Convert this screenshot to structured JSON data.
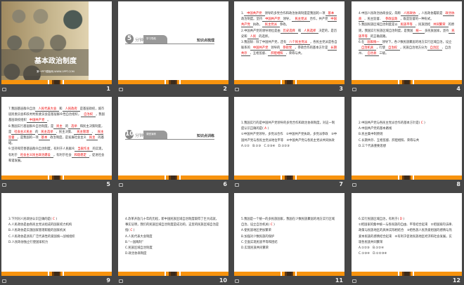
{
  "slides": [
    {
      "num": "1",
      "type": "title",
      "title": "基本政治制度",
      "subtitle": "第一PPT模板网-WWW.1PPT.COM"
    },
    {
      "num": "2",
      "type": "section",
      "badge_num": "5",
      "badge_label": "分钟",
      "badge_tag": "学习导航",
      "heading": "知识点梳理"
    },
    {
      "num": "3",
      "type": "text",
      "paras": [
        [
          [
            "1.",
            0
          ],
          [
            "中国共产党",
            1
          ],
          [
            "领导的多党合作和政治协商制度是我国的一项",
            0
          ],
          [
            "基本",
            1
          ],
          [
            "政治制度。坚持",
            0
          ],
          [
            "中国共产党",
            1
          ],
          [
            "领导，",
            0
          ],
          [
            "民主党派",
            1
          ],
          [
            "合作，共产党",
            0
          ],
          [
            "中国共产党",
            1
          ],
          [
            "执政，",
            0
          ],
          [
            "民主党派",
            1
          ],
          [
            "参政。",
            0
          ]
        ],
        [
          [
            "2.中国共产党的领导地位是由",
            0
          ],
          [
            "历史选择",
            1
          ],
          [
            "和",
            0
          ],
          [
            "人民选择",
            1
          ],
          [
            "决定的，是历史和",
            0
          ],
          [
            "人民",
            1
          ],
          [
            "的选择。",
            0
          ]
        ],
        [
          [
            "3.我国除：除了中国共产党，还有",
            0
          ],
          [
            "八个民主党派",
            1
          ],
          [
            "，各民主党派是各自联系的",
            0
          ],
          [
            "中国共产党",
            1
          ],
          [
            "领导的",
            0
          ],
          [
            "参政党",
            1
          ],
          [
            "，参政合作的基本方针是",
            0
          ],
          [
            "长期共存",
            1
          ],
          [
            "、互相监督、",
            0
          ],
          [
            "肝胆相照",
            1
          ],
          [
            "、荣辱与共。",
            0
          ]
        ]
      ]
    },
    {
      "num": "4",
      "type": "text",
      "paras": [
        [
          [
            "4.中国人民政治协商会议，简称",
            0
          ],
          [
            "人民政协",
            1
          ],
          [
            "，人民政协履职是",
            0
          ],
          [
            "政治协商",
            1
          ],
          [
            "、民主监督、",
            0
          ],
          [
            "参政议政",
            1
          ],
          [
            "，既是监督的一种形式。",
            0
          ]
        ],
        [
          [
            "5.我国民族区域自治制度是以",
            0
          ],
          [
            "民族平等",
            1
          ],
          [
            "、民族团结",
            0
          ],
          [
            "共同繁荣",
            1
          ],
          [
            "的原则，我国实行民族区域自治制度，是我国",
            0
          ],
          [
            "统一",
            1
          ],
          [
            "多民族国家，坚持",
            0
          ],
          [
            "民族平等",
            1
          ],
          [
            "的正确道路。",
            0
          ]
        ],
        [
          [
            "6.在",
            0
          ],
          [
            "国家统一",
            1
          ],
          [
            "领导下，各少数民族聚居的地方实行区域自治，设立",
            0
          ],
          [
            "自治机关",
            1
          ],
          [
            "，行使",
            0
          ],
          [
            "自治权",
            1
          ],
          [
            "，民族自治地方分为",
            0
          ],
          [
            "自治区",
            1
          ],
          [
            "、自治州、",
            0
          ],
          [
            "自治县",
            1
          ],
          [
            "三级。",
            0
          ]
        ]
      ]
    },
    {
      "num": "5",
      "type": "text",
      "paras": [
        [
          [
            "7.我国基层群众自治",
            0
          ],
          [
            "人民代表大会",
            1
          ],
          [
            "和",
            0
          ],
          [
            "人民政府",
            1
          ],
          [
            "是基层政权，城市居民委员会和农村村民委员会是基层群众性自治组织，",
            0
          ],
          [
            "自治权",
            1
          ],
          [
            "，我国基层政权组织",
            0
          ],
          [
            "中国共产党",
            1
          ],
          [
            "。",
            0
          ]
        ],
        [
          [
            "8.我国实行基层群众自治制度，是",
            0
          ],
          [
            "民主",
            1
          ],
          [
            "的",
            0
          ],
          [
            "选举",
            1
          ],
          [
            "和民主决策制度，是",
            0
          ],
          [
            "社会主义民主",
            1
          ],
          [
            "的",
            0
          ],
          [
            "民主选举",
            1
          ],
          [
            "、民主决策、",
            0
          ],
          [
            "民主管理",
            1
          ],
          [
            "、",
            0
          ],
          [
            "民主监督",
            1
          ],
          [
            "，是我国的一项",
            0
          ],
          [
            "基本",
            1
          ],
          [
            "政治制度，是发展社会主义",
            0
          ],
          [
            "民主",
            1
          ],
          [
            "的基础。",
            0
          ]
        ],
        [
          [
            "9.坚持和完善基层群众自治制度，有利于人民群众",
            0
          ],
          [
            "当家作主",
            1
          ],
          [
            "的实现，有利于",
            0
          ],
          [
            "社会主义民主政治建设",
            1
          ],
          [
            "，有利于社会",
            0
          ],
          [
            "和谐稳定",
            1
          ],
          [
            "，促进社会和谐发展。",
            0
          ]
        ]
      ]
    },
    {
      "num": "6",
      "type": "section",
      "badge_num": "10",
      "badge_label": "分钟",
      "badge_tag": "课堂演练",
      "heading": "知识点训练"
    },
    {
      "num": "7",
      "type": "text",
      "paras": [
        [
          [
            "1.我国实行的是中国共产党领导的多党合作和政治协商制度，对这一制度认识正确的是(",
            0
          ],
          [
            " A ",
            2
          ],
          [
            ")",
            0
          ]
        ],
        [
          [
            "①中国共产党领导，多党派合作　②中国共产党执政，多党派参政　③中国共产党与各民主党派地位平等　④中国共产党与各民主党派共同执政",
            0
          ]
        ],
        [
          [
            "A.①②　B.①③　C.②③④　D.①②③",
            0
          ]
        ]
      ]
    },
    {
      "num": "8",
      "type": "text",
      "paras": [
        [
          [
            "2.中国共产党与各民主党派合作的基本方针是(",
            0
          ],
          [
            " C ",
            2
          ],
          [
            ")",
            0
          ]
        ],
        [
          [
            "A.中国共产党的基本路线",
            0
          ]
        ],
        [
          [
            "B.民主集中制原则",
            0
          ]
        ],
        [
          [
            "C.长期共存、互相监督、肝胆相照、荣辱与共",
            0
          ]
        ],
        [
          [
            "D.三个代表重要思想",
            0
          ]
        ]
      ]
    },
    {
      "num": "9",
      "type": "text",
      "paras": [
        [
          [
            "3.下列对人民政协认识正确的是(",
            0
          ],
          [
            " C ",
            2
          ],
          [
            ")",
            0
          ]
        ],
        [
          [
            "A.人民政协是由各民主党派组成的国家权力机构",
            0
          ]
        ],
        [
          [
            "B.人民政协是实施国家管理职能的国家机关",
            0
          ]
        ],
        [
          [
            "C.人民政协是具有广泛代表性的爱国统一战线组织",
            0
          ]
        ],
        [
          [
            "D.人民政协独立行使国家权力",
            0
          ]
        ]
      ]
    },
    {
      "num": "10",
      "type": "text",
      "paras": [
        [
          [
            "4.改革开放几十年的历程，新中国民族区域自治制度取得了巨大成就，事实证明，我们的民族区域自治制度是成功的，这里的民族区域自治是指(",
            0
          ],
          [
            " C ",
            2
          ],
          [
            ")",
            0
          ]
        ],
        [
          [
            "A.人民代表大会制度",
            0
          ]
        ],
        [
          [
            "B.“一国两制”",
            0
          ]
        ],
        [
          [
            "C.民族区域自治制度",
            0
          ]
        ],
        [
          [
            "D.政治协商制度",
            0
          ]
        ]
      ]
    },
    {
      "num": "11",
      "type": "text",
      "paras": [
        [
          [
            "5.我国是一个统一的多民族国家，我国在少数民族聚居的地方实行区域自治，设立自治机关(",
            0
          ],
          [
            " C ",
            2
          ],
          [
            ")",
            0
          ]
        ],
        [
          [
            "A.使民族地区更加繁荣",
            0
          ]
        ],
        [
          [
            "B.加强对少数民族的保护",
            0
          ]
        ],
        [
          [
            "C.全面实现民族平等和团结",
            0
          ]
        ],
        [
          [
            "D.实现民族共同繁荣",
            0
          ]
        ]
      ]
    },
    {
      "num": "12",
      "type": "text",
      "paras": [
        [
          [
            "6.实行民族区域自治，有利于(",
            0
          ],
          [
            " D ",
            2
          ],
          [
            ")",
            0
          ]
        ],
        [
          [
            "①把国家的集中统一与各民族的自由、平等结合起来　②把国家的法律、政策与民族地区的具体实际相结合　③把各族人民热爱祖国的感情与热爱本民族的感情结合起来　④有利于促进民族地区经济和社会发展，实现各民族共同繁荣",
            0
          ]
        ],
        [
          [
            "A.①②③　B.①②④",
            0
          ]
        ],
        [
          [
            "C.①③④　D.①②③④",
            0
          ]
        ]
      ]
    }
  ]
}
